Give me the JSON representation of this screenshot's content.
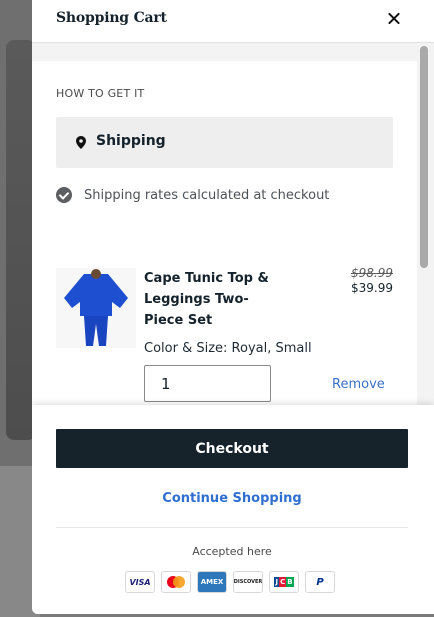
{
  "header": {
    "title": "Shopping Cart"
  },
  "shipping": {
    "heading": "HOW TO GET IT",
    "method": "Shipping",
    "note": "Shipping rates calculated at checkout"
  },
  "cart_item": {
    "name": "Cape Tunic Top & Leggings Two-Piece Set",
    "price_original": "$98.99",
    "price_sale": "$39.99",
    "variant": "Color & Size: Royal, Small",
    "quantity": "1",
    "remove_label": "Remove"
  },
  "footer": {
    "checkout_label": "Checkout",
    "continue_label": "Continue Shopping",
    "accepted_label": "Accepted here",
    "payment_icons": [
      "visa-icon",
      "mastercard-icon",
      "amex-icon",
      "discover-icon",
      "jcb-icon",
      "paypal-icon"
    ],
    "payment_text": {
      "visa": "VISA",
      "amex": "AMEX",
      "discover": "DISCOVER",
      "jcb": "JCB"
    }
  },
  "colors": {
    "checkout_bg": "#16232b",
    "link": "#2f6fd0",
    "product": "#1f4fd1"
  }
}
